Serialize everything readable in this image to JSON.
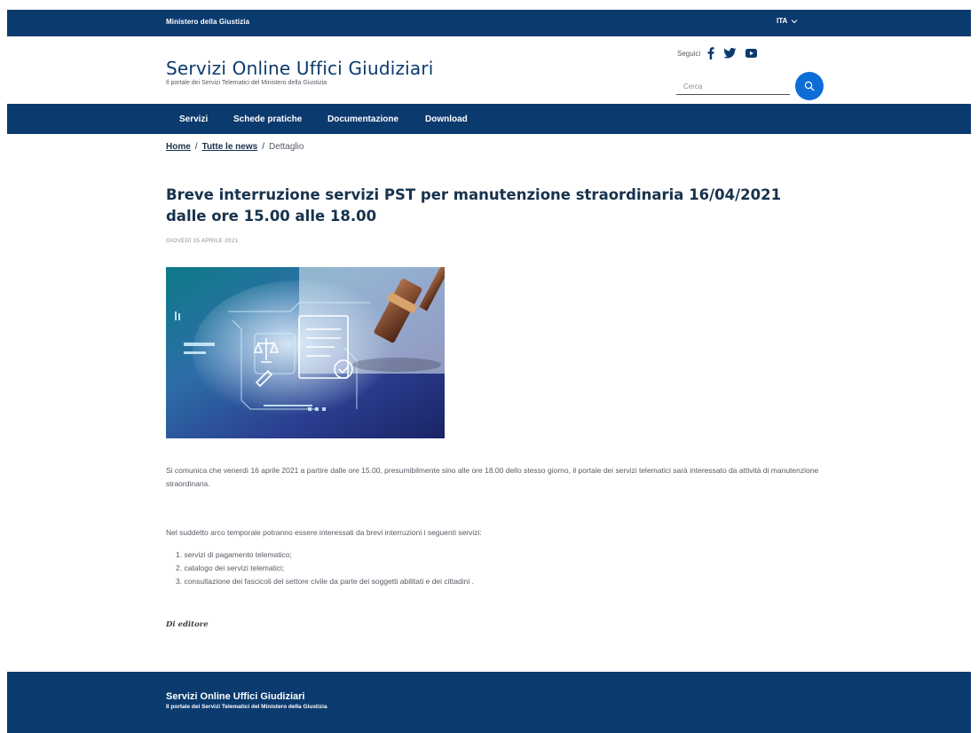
{
  "topbar": {
    "org": "Ministero della Giustizia",
    "language": "ITA"
  },
  "header": {
    "title": "Servizi Online Uffici Giudiziari",
    "subtitle": "Il portale dei Servizi Telematici del Ministero della Giustizia",
    "follow_label": "Seguici",
    "social_icons": [
      "facebook-icon",
      "twitter-icon",
      "youtube-icon"
    ],
    "search_placeholder": "Cerca"
  },
  "nav": {
    "items": [
      "Servizi",
      "Schede pratiche",
      "Documentazione",
      "Download"
    ]
  },
  "breadcrumb": {
    "home": "Home",
    "news": "Tutte le news",
    "current": "Dettaglio",
    "separator": "/"
  },
  "article": {
    "title": "Breve interruzione servizi PST per manutenzione straordinaria 16/04/2021 dalle ore 15.00 alle 18.00",
    "date": "GIOVEDÌ 15 APRILE 2021",
    "paragraph1": "Si comunica che venerdì 16 aprile 2021 a partire dalle ore 15.00, presumibilmente sino alle ore 18.00 dello stesso giorno, il portale dei servizi telematici sarà interessato da attività di manutenzione straordinaria.",
    "paragraph2": "Nel suddetto arco temporale potranno essere interessati da brevi interruzioni i seguenti servizi:",
    "list": [
      "1. servizi di pagamento telematico;",
      "2. catalogo dei servizi telematici;",
      "3. consultazione dei fascicoli del settore civile da parte dei soggetti abilitati e dei cittadini ."
    ],
    "author": "Di editore"
  },
  "footer": {
    "title": "Servizi Online Uffici Giudiziari",
    "subtitle": "Il portale dei Servizi Telematici del Ministero della Giustizia"
  },
  "colors": {
    "primary": "#0b3a6e",
    "accent": "#0d6dd6",
    "text": "#555b63"
  }
}
